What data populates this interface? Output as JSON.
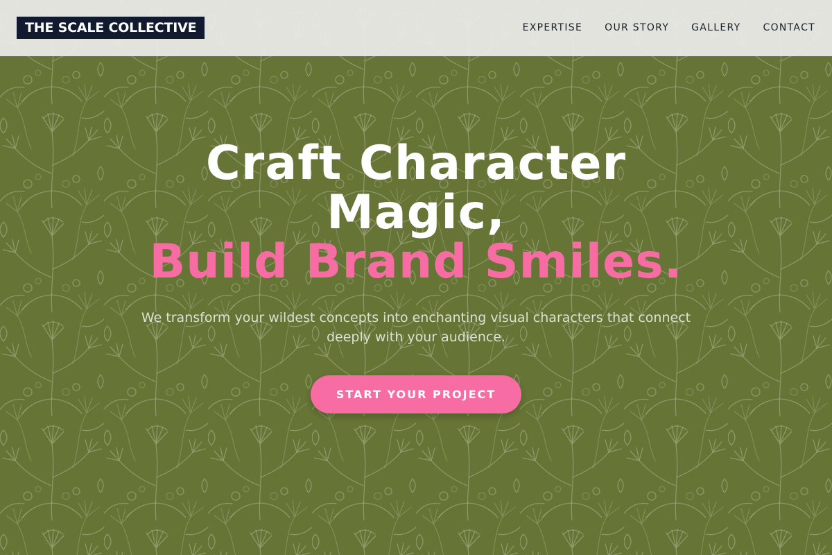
{
  "brand": {
    "name": "THE SCALE COLLECTIVE",
    "logo_bg": "#121a30"
  },
  "nav": {
    "items": [
      {
        "label": "EXPERTISE"
      },
      {
        "label": "OUR STORY"
      },
      {
        "label": "GALLERY"
      },
      {
        "label": "CONTACT"
      }
    ]
  },
  "hero": {
    "headline_line1": "Craft Character",
    "headline_line2": "Magic,",
    "headline_accent": "Build Brand Smiles.",
    "subtext": "We transform your wildest concepts into enchanting visual characters that connect deeply with your audience.",
    "cta_label": "START YOUR PROJECT",
    "background": "leaf-pattern"
  },
  "colors": {
    "accent": "#f76da3",
    "background": "#6b7a3a",
    "header_bg": "#ececea",
    "headline": "#ffffff"
  }
}
